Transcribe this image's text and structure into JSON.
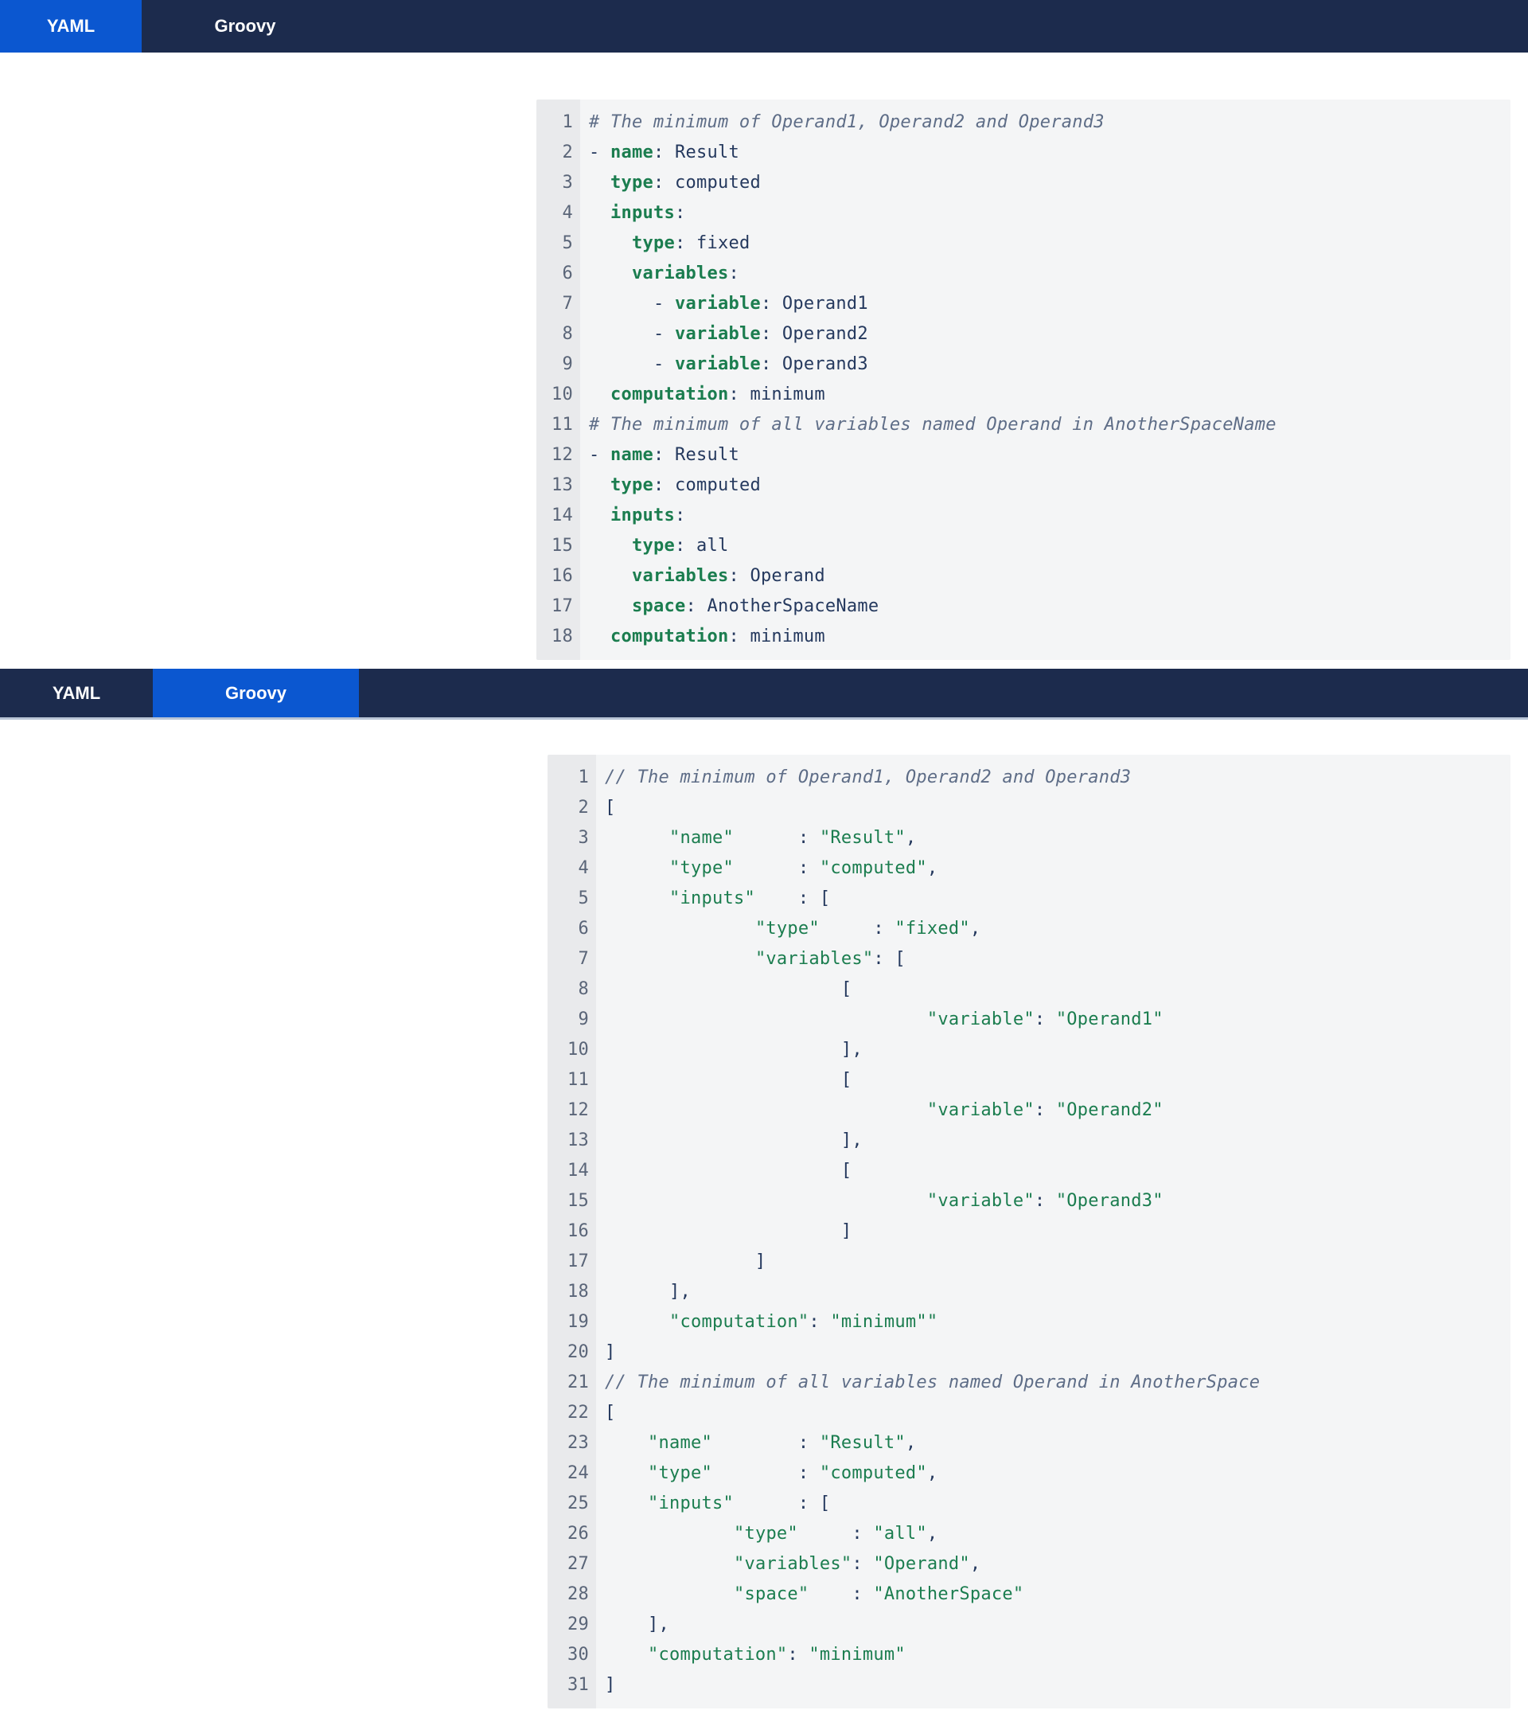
{
  "colors": {
    "accent_blue": "#0b57d0",
    "navy_bar": "#1c2b4d",
    "key_green": "#1b7d4f",
    "code_text": "#25395e",
    "comment_gray": "#5e6d87",
    "gutter_bg": "#e9eaec",
    "code_bg": "#f4f5f6",
    "line_number": "#5a6578"
  },
  "top_tabbar": {
    "tabs": [
      {
        "label": "YAML",
        "active": true
      },
      {
        "label": "Groovy",
        "active": false
      }
    ]
  },
  "bottom_tabbar": {
    "tabs": [
      {
        "label": "YAML",
        "active": false
      },
      {
        "label": "Groovy",
        "active": true
      }
    ]
  },
  "yaml_block": {
    "language": "YAML",
    "lines": [
      [
        {
          "c": "cm",
          "t": "# The minimum of Operand1, Operand2 and Operand3"
        }
      ],
      [
        {
          "c": "p",
          "t": "- "
        },
        {
          "c": "k",
          "t": "name"
        },
        {
          "c": "p",
          "t": ": Result"
        }
      ],
      [
        {
          "c": "p",
          "t": "  "
        },
        {
          "c": "k",
          "t": "type"
        },
        {
          "c": "p",
          "t": ": computed"
        }
      ],
      [
        {
          "c": "p",
          "t": "  "
        },
        {
          "c": "k",
          "t": "inputs"
        },
        {
          "c": "p",
          "t": ":"
        }
      ],
      [
        {
          "c": "p",
          "t": "    "
        },
        {
          "c": "k",
          "t": "type"
        },
        {
          "c": "p",
          "t": ": fixed"
        }
      ],
      [
        {
          "c": "p",
          "t": "    "
        },
        {
          "c": "k",
          "t": "variables"
        },
        {
          "c": "p",
          "t": ":"
        }
      ],
      [
        {
          "c": "p",
          "t": "      - "
        },
        {
          "c": "k",
          "t": "variable"
        },
        {
          "c": "p",
          "t": ": Operand1"
        }
      ],
      [
        {
          "c": "p",
          "t": "      - "
        },
        {
          "c": "k",
          "t": "variable"
        },
        {
          "c": "p",
          "t": ": Operand2"
        }
      ],
      [
        {
          "c": "p",
          "t": "      - "
        },
        {
          "c": "k",
          "t": "variable"
        },
        {
          "c": "p",
          "t": ": Operand3"
        }
      ],
      [
        {
          "c": "p",
          "t": "  "
        },
        {
          "c": "k",
          "t": "computation"
        },
        {
          "c": "p",
          "t": ": minimum"
        }
      ],
      [
        {
          "c": "cm",
          "t": "# The minimum of all variables named Operand in AnotherSpaceName"
        }
      ],
      [
        {
          "c": "p",
          "t": "- "
        },
        {
          "c": "k",
          "t": "name"
        },
        {
          "c": "p",
          "t": ": Result"
        }
      ],
      [
        {
          "c": "p",
          "t": "  "
        },
        {
          "c": "k",
          "t": "type"
        },
        {
          "c": "p",
          "t": ": computed"
        }
      ],
      [
        {
          "c": "p",
          "t": "  "
        },
        {
          "c": "k",
          "t": "inputs"
        },
        {
          "c": "p",
          "t": ":"
        }
      ],
      [
        {
          "c": "p",
          "t": "    "
        },
        {
          "c": "k",
          "t": "type"
        },
        {
          "c": "p",
          "t": ": all"
        }
      ],
      [
        {
          "c": "p",
          "t": "    "
        },
        {
          "c": "k",
          "t": "variables"
        },
        {
          "c": "p",
          "t": ": Operand"
        }
      ],
      [
        {
          "c": "p",
          "t": "    "
        },
        {
          "c": "k",
          "t": "space"
        },
        {
          "c": "p",
          "t": ": AnotherSpaceName"
        }
      ],
      [
        {
          "c": "p",
          "t": "  "
        },
        {
          "c": "k",
          "t": "computation"
        },
        {
          "c": "p",
          "t": ": minimum"
        }
      ]
    ]
  },
  "groovy_block": {
    "language": "Groovy",
    "lines": [
      [
        {
          "c": "cm",
          "t": "// The minimum of Operand1, Operand2 and Operand3"
        }
      ],
      [
        {
          "c": "p",
          "t": "["
        }
      ],
      [
        {
          "c": "p",
          "t": "      "
        },
        {
          "c": "s",
          "t": "\"name\""
        },
        {
          "c": "p",
          "t": "      : "
        },
        {
          "c": "s",
          "t": "\"Result\""
        },
        {
          "c": "p",
          "t": ","
        }
      ],
      [
        {
          "c": "p",
          "t": "      "
        },
        {
          "c": "s",
          "t": "\"type\""
        },
        {
          "c": "p",
          "t": "      : "
        },
        {
          "c": "s",
          "t": "\"computed\""
        },
        {
          "c": "p",
          "t": ","
        }
      ],
      [
        {
          "c": "p",
          "t": "      "
        },
        {
          "c": "s",
          "t": "\"inputs\""
        },
        {
          "c": "p",
          "t": "    : ["
        }
      ],
      [
        {
          "c": "p",
          "t": "              "
        },
        {
          "c": "s",
          "t": "\"type\""
        },
        {
          "c": "p",
          "t": "     : "
        },
        {
          "c": "s",
          "t": "\"fixed\""
        },
        {
          "c": "p",
          "t": ","
        }
      ],
      [
        {
          "c": "p",
          "t": "              "
        },
        {
          "c": "s",
          "t": "\"variables\""
        },
        {
          "c": "p",
          "t": ": ["
        }
      ],
      [
        {
          "c": "p",
          "t": "                      ["
        }
      ],
      [
        {
          "c": "p",
          "t": "                              "
        },
        {
          "c": "s",
          "t": "\"variable\""
        },
        {
          "c": "p",
          "t": ": "
        },
        {
          "c": "s",
          "t": "\"Operand1\""
        }
      ],
      [
        {
          "c": "p",
          "t": "                      ],"
        }
      ],
      [
        {
          "c": "p",
          "t": "                      ["
        }
      ],
      [
        {
          "c": "p",
          "t": "                              "
        },
        {
          "c": "s",
          "t": "\"variable\""
        },
        {
          "c": "p",
          "t": ": "
        },
        {
          "c": "s",
          "t": "\"Operand2\""
        }
      ],
      [
        {
          "c": "p",
          "t": "                      ],"
        }
      ],
      [
        {
          "c": "p",
          "t": "                      ["
        }
      ],
      [
        {
          "c": "p",
          "t": "                              "
        },
        {
          "c": "s",
          "t": "\"variable\""
        },
        {
          "c": "p",
          "t": ": "
        },
        {
          "c": "s",
          "t": "\"Operand3\""
        }
      ],
      [
        {
          "c": "p",
          "t": "                      ]"
        }
      ],
      [
        {
          "c": "p",
          "t": "              ]"
        }
      ],
      [
        {
          "c": "p",
          "t": "      ],"
        }
      ],
      [
        {
          "c": "p",
          "t": "      "
        },
        {
          "c": "s",
          "t": "\"computation\""
        },
        {
          "c": "p",
          "t": ": "
        },
        {
          "c": "s",
          "t": "\"minimum\"\""
        }
      ],
      [
        {
          "c": "p",
          "t": "]"
        }
      ],
      [
        {
          "c": "cm",
          "t": "// The minimum of all variables named Operand in AnotherSpace"
        }
      ],
      [
        {
          "c": "p",
          "t": "["
        }
      ],
      [
        {
          "c": "p",
          "t": "    "
        },
        {
          "c": "s",
          "t": "\"name\""
        },
        {
          "c": "p",
          "t": "        : "
        },
        {
          "c": "s",
          "t": "\"Result\""
        },
        {
          "c": "p",
          "t": ","
        }
      ],
      [
        {
          "c": "p",
          "t": "    "
        },
        {
          "c": "s",
          "t": "\"type\""
        },
        {
          "c": "p",
          "t": "        : "
        },
        {
          "c": "s",
          "t": "\"computed\""
        },
        {
          "c": "p",
          "t": ","
        }
      ],
      [
        {
          "c": "p",
          "t": "    "
        },
        {
          "c": "s",
          "t": "\"inputs\""
        },
        {
          "c": "p",
          "t": "      : ["
        }
      ],
      [
        {
          "c": "p",
          "t": "            "
        },
        {
          "c": "s",
          "t": "\"type\""
        },
        {
          "c": "p",
          "t": "     : "
        },
        {
          "c": "s",
          "t": "\"all\""
        },
        {
          "c": "p",
          "t": ","
        }
      ],
      [
        {
          "c": "p",
          "t": "            "
        },
        {
          "c": "s",
          "t": "\"variables\""
        },
        {
          "c": "p",
          "t": ": "
        },
        {
          "c": "s",
          "t": "\"Operand\""
        },
        {
          "c": "p",
          "t": ","
        }
      ],
      [
        {
          "c": "p",
          "t": "            "
        },
        {
          "c": "s",
          "t": "\"space\""
        },
        {
          "c": "p",
          "t": "    : "
        },
        {
          "c": "s",
          "t": "\"AnotherSpace\""
        }
      ],
      [
        {
          "c": "p",
          "t": "    ],"
        }
      ],
      [
        {
          "c": "p",
          "t": "    "
        },
        {
          "c": "s",
          "t": "\"computation\""
        },
        {
          "c": "p",
          "t": ": "
        },
        {
          "c": "s",
          "t": "\"minimum\""
        }
      ],
      [
        {
          "c": "p",
          "t": "]"
        }
      ]
    ]
  }
}
